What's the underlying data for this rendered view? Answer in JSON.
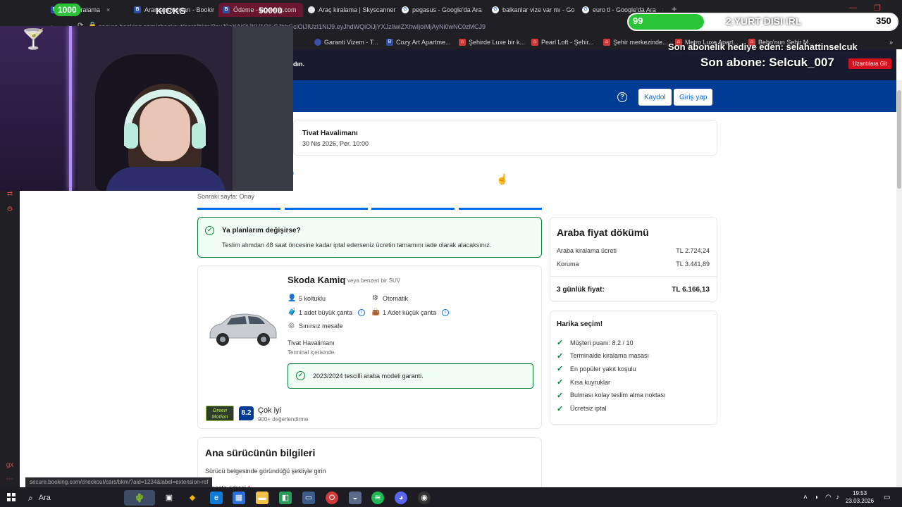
{
  "browser": {
    "tabs": [
      {
        "label": "Araç kiralama",
        "fav": "b"
      },
      {
        "label": "Arama sonuçları - Booking",
        "fav": "b"
      },
      {
        "label": "Ödeme - Booking.com",
        "fav": "b",
        "active": true
      },
      {
        "label": "Araç kiralama | Skyscanner",
        "fav": "s"
      },
      {
        "label": "pegasus - Google'da Ara",
        "fav": "g"
      },
      {
        "label": "balkanlar vize var mı - Go",
        "fav": "g"
      },
      {
        "label": "euro tl - Google'da Ara",
        "fav": "g"
      }
    ],
    "new_tab": "+",
    "url": "secure.booking.com/checkout/cars/bkm/?eyJ0eXAiOiJKV1QiLCJhbGciOiJIUzI1NiJ9.eyJhdWQiOiJjYXJzIiwiZXhwIjoiMjAyNi0wNC0zMCJ9",
    "bookmarks": [
      {
        "label": "Garanti Vizem - T...",
        "fav": "p"
      },
      {
        "label": "Cozy Art Apartme...",
        "fav": "b"
      },
      {
        "label": "Şehirde Luxe bir k...",
        "fav": "r"
      },
      {
        "label": "Pearl Loft - Şehir...",
        "fav": "r"
      },
      {
        "label": "Şehir merkezinde...",
        "fav": "r"
      },
      {
        "label": "Metro Luxe Apart...",
        "fav": "r"
      },
      {
        "label": "Bebo'nun Şehir M...",
        "fav": "r"
      }
    ],
    "status_url": "secure.booking.com/checkout/cars/bkm/?aid=1234&label=extension-ref"
  },
  "site": {
    "notice_fragment": "dın.",
    "header": {
      "help_icon": "?",
      "register": "Kaydol",
      "signin": "Giriş yap"
    },
    "pickup": {
      "title": "Tivat Havalimanı",
      "date": "30 Nis 2026, Per. 10:00"
    },
    "next_page": "Sonraki sayfa: Onay",
    "cancel": {
      "title": "Ya planlarım değişirse?",
      "text": "Teslim alımdan 48 saat öncesine kadar iptal ederseniz ücretin tamamını iade olarak alacaksınız."
    },
    "car": {
      "name": "Skoda Kamiq",
      "sub": "veya benzeri bir SUV",
      "features": {
        "seats": "5 koltuklu",
        "transmission": "Otomatik",
        "big_bag": "1 adet büyük çanta",
        "small_bag": "1 Adet küçük çanta",
        "mileage": "Sınırsız mesafe"
      },
      "location": "Tivat Havalimanı",
      "location_sub": "Terminal içerisinde",
      "guarantee": "2023/2024 tescilli araba modeli garanti."
    },
    "supplier": {
      "logo": "Green Motion",
      "score": "8.2",
      "word": "Çok iyi",
      "count": "900+ değerlendirme"
    },
    "driver": {
      "title": "Ana sürücünün bilgileri",
      "subtitle": "Sürücü belgesinde göründüğü şekliyle girin",
      "email_label": "E-posta adresi",
      "required": "*"
    },
    "price": {
      "title": "Araba fiyat dökümü",
      "rental_label": "Araba kiralama ücreti",
      "rental_value": "TL 2.724,24",
      "protection_label": "Koruma",
      "protection_value": "TL 3.441,89",
      "total_label": "3 günlük fiyat:",
      "total_value": "TL 6.166,13"
    },
    "great_choice": {
      "title": "Harika seçim!",
      "items": [
        "Müşteri puanı: 8.2 / 10",
        "Terminalde kiralama masası",
        "En popüler yakıt koşulu",
        "Kısa kuyruklar",
        "Bulması kolay teslim alma noktası",
        "Ücretsiz iptal"
      ]
    }
  },
  "overlay": {
    "kicks_count": "1000",
    "kicks_label": "KICKS",
    "kicks_goal": "50000",
    "sub_goal_count": "99",
    "sub_goal_title": "2.YURT DISI IRL",
    "sub_goal_target": "350",
    "sub_goal_progress": 0.28,
    "gift_text": "Son abonelik hediye eden: selahattinselcuk",
    "last_sub": "Son abone: Selcuk_007",
    "currency_button": "Uzantılara Git"
  },
  "taskbar": {
    "search_placeholder": "Ara",
    "time": "19:53",
    "date": "23.03.2026"
  }
}
